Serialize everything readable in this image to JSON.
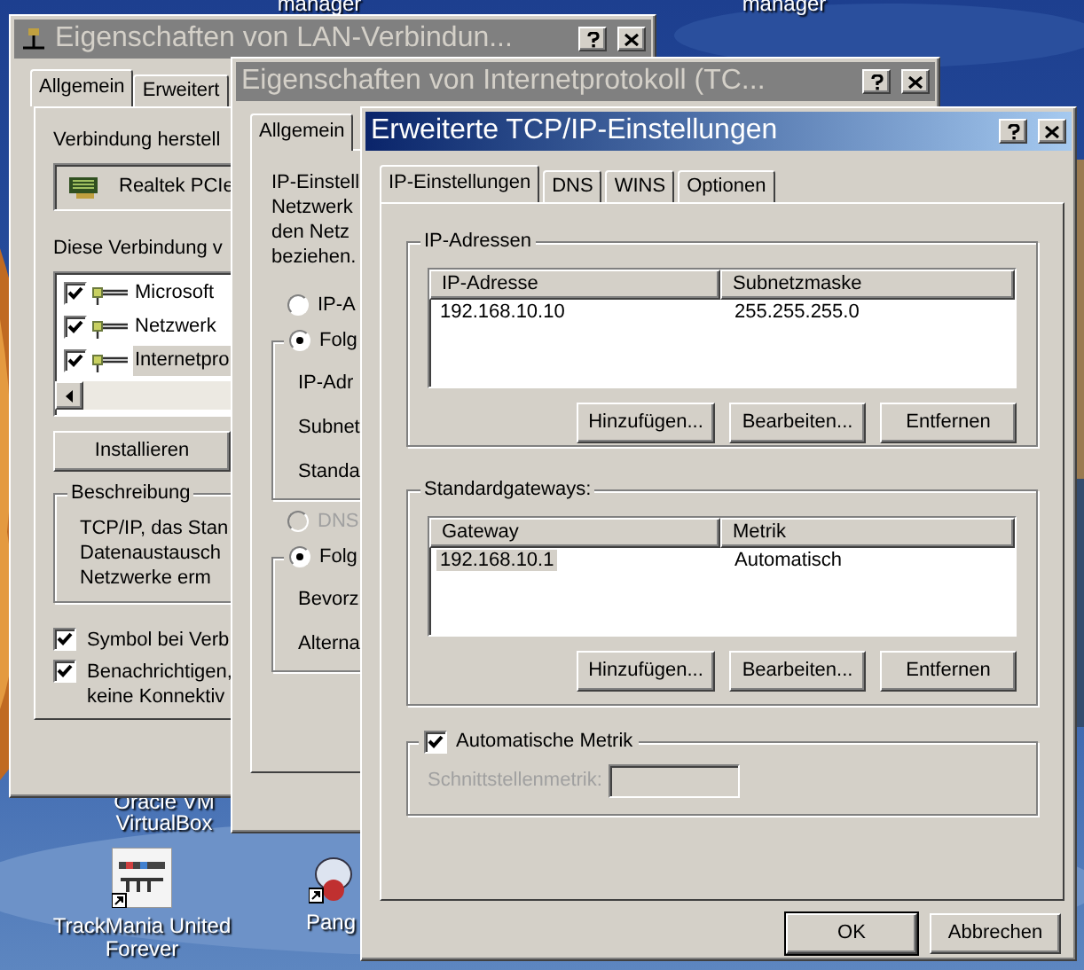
{
  "desktop_icons": [
    {
      "kind": "label",
      "lines": [
        "manager"
      ]
    },
    {
      "kind": "label",
      "lines": [
        "manager"
      ]
    },
    {
      "kind": "label",
      "lines": [
        "Oracle VM",
        "VirtualBox"
      ]
    },
    {
      "kind": "tile",
      "lines": [
        "TrackMania United",
        "Forever"
      ]
    },
    {
      "kind": "mascot",
      "lines": [
        "Pang"
      ]
    }
  ],
  "lan_window": {
    "title": "Eigenschaften von LAN-Verbindun...",
    "active": false,
    "tabs": [
      {
        "label": "Allgemein",
        "selected": true
      },
      {
        "label": "Erweitert",
        "selected": false
      }
    ],
    "connect_label": "Verbindung herstell",
    "adapter": "Realtek PCIe",
    "components_label": "Diese Verbindung v",
    "components": [
      {
        "label": "Microsoft",
        "checked": true,
        "selected": false
      },
      {
        "label": "Netzwerk",
        "checked": true,
        "selected": false
      },
      {
        "label": "Internetpro",
        "checked": true,
        "selected": true
      }
    ],
    "install_button": "Installieren",
    "description": {
      "legend": "Beschreibung",
      "lines": [
        "TCP/IP, das Stan",
        "Datenaustausch",
        "Netzwerke erm"
      ]
    },
    "options": [
      {
        "lines": [
          "Symbol bei Verb"
        ],
        "checked": true
      },
      {
        "lines": [
          "Benachrichtigen,",
          "keine Konnektiv"
        ],
        "checked": true
      }
    ]
  },
  "tcpip_window": {
    "title": "Eigenschaften von Internetprotokoll (TC...",
    "active": false,
    "tabs": [
      {
        "label": "Allgemein",
        "selected": true
      }
    ],
    "intro": [
      "IP-Einstell",
      "Netzwerk",
      "den Netz",
      "beziehen."
    ],
    "sections": [
      {
        "radio_auto": {
          "label": "IP-A",
          "selected": false,
          "disabled": false
        },
        "radio_manual": {
          "label": "Folg",
          "selected": true
        },
        "fields": [
          "IP-Adr",
          "Subnet",
          "Standa"
        ]
      },
      {
        "radio_auto": {
          "label": "DNS",
          "selected": false,
          "disabled": true
        },
        "radio_manual": {
          "label": "Folg",
          "selected": true
        },
        "fields": [
          "Bevorz",
          "Alterna"
        ]
      }
    ]
  },
  "advanced_window": {
    "title": "Erweiterte TCP/IP-Einstellungen",
    "active": true,
    "tabs": [
      {
        "label": "IP-Einstellungen",
        "selected": true
      },
      {
        "label": "DNS",
        "selected": false
      },
      {
        "label": "WINS",
        "selected": false
      },
      {
        "label": "Optionen",
        "selected": false
      }
    ],
    "ip_addresses": {
      "legend": "IP-Adressen",
      "columns": [
        "IP-Adresse",
        "Subnetzmaske"
      ],
      "rows": [
        {
          "cells": [
            "192.168.10.10",
            "255.255.255.0"
          ],
          "selected": false
        }
      ],
      "buttons": [
        "Hinzufügen...",
        "Bearbeiten...",
        "Entfernen"
      ]
    },
    "gateways": {
      "legend": "Standardgateways:",
      "columns": [
        "Gateway",
        "Metrik"
      ],
      "rows": [
        {
          "cells": [
            "192.168.10.1",
            "Automatisch"
          ],
          "selected": true
        }
      ],
      "buttons": [
        "Hinzufügen...",
        "Bearbeiten...",
        "Entfernen"
      ]
    },
    "auto_metric": {
      "label": "Automatische Metrik",
      "checked": true,
      "field_label": "Schnittstellenmetrik:",
      "field_disabled": true
    },
    "buttons": [
      {
        "label": "OK",
        "default": true
      },
      {
        "label": "Abbrechen",
        "default": false
      }
    ]
  }
}
